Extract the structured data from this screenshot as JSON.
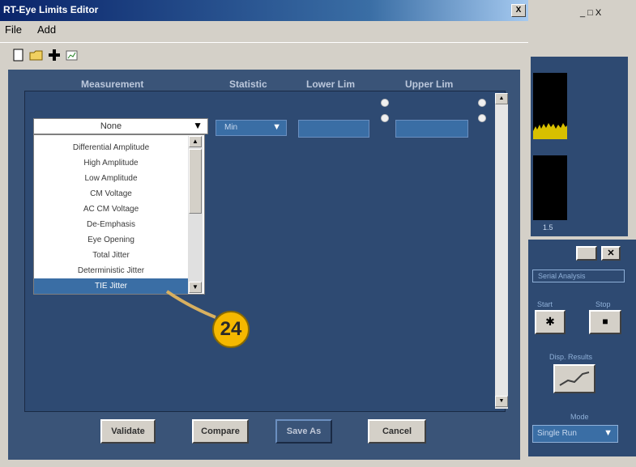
{
  "window": {
    "title": "RT-Eye Limits Editor",
    "close_glyph": "X"
  },
  "menu": {
    "file": "File",
    "add": "Add"
  },
  "toolbar": {
    "icons": [
      "new-file-icon",
      "open-folder-icon",
      "add-icon",
      "chart-icon"
    ]
  },
  "columns": {
    "measurement": "Measurement",
    "statistic": "Statistic",
    "lower": "Lower Lim",
    "upper": "Upper Lim"
  },
  "measurement_select": {
    "value": "None",
    "options": [
      "Differential Amplitude",
      "High Amplitude",
      "Low Amplitude",
      "CM Voltage",
      "AC CM Voltage",
      "De-Emphasis",
      "Eye Opening",
      "Total Jitter",
      "Deterministic Jitter",
      "TIE Jitter"
    ],
    "selected_index": 9
  },
  "statistic_select": {
    "value": "Min"
  },
  "buttons": {
    "validate": "Validate",
    "compare": "Compare",
    "save_as": "Save As",
    "cancel": "Cancel"
  },
  "callout": {
    "number": "24"
  },
  "background_app": {
    "window_buttons": "_ □ X",
    "scope_readout": "1.5",
    "panel_title": "Serial Analysis",
    "start_label": "Start",
    "stop_label": "Stop",
    "results_label": "Disp. Results",
    "mode_label": "Mode",
    "mode_value": "Single Run"
  },
  "colors": {
    "client_bg": "#3a5478",
    "accent": "#3a6ea5",
    "callout": "#f5b800"
  }
}
